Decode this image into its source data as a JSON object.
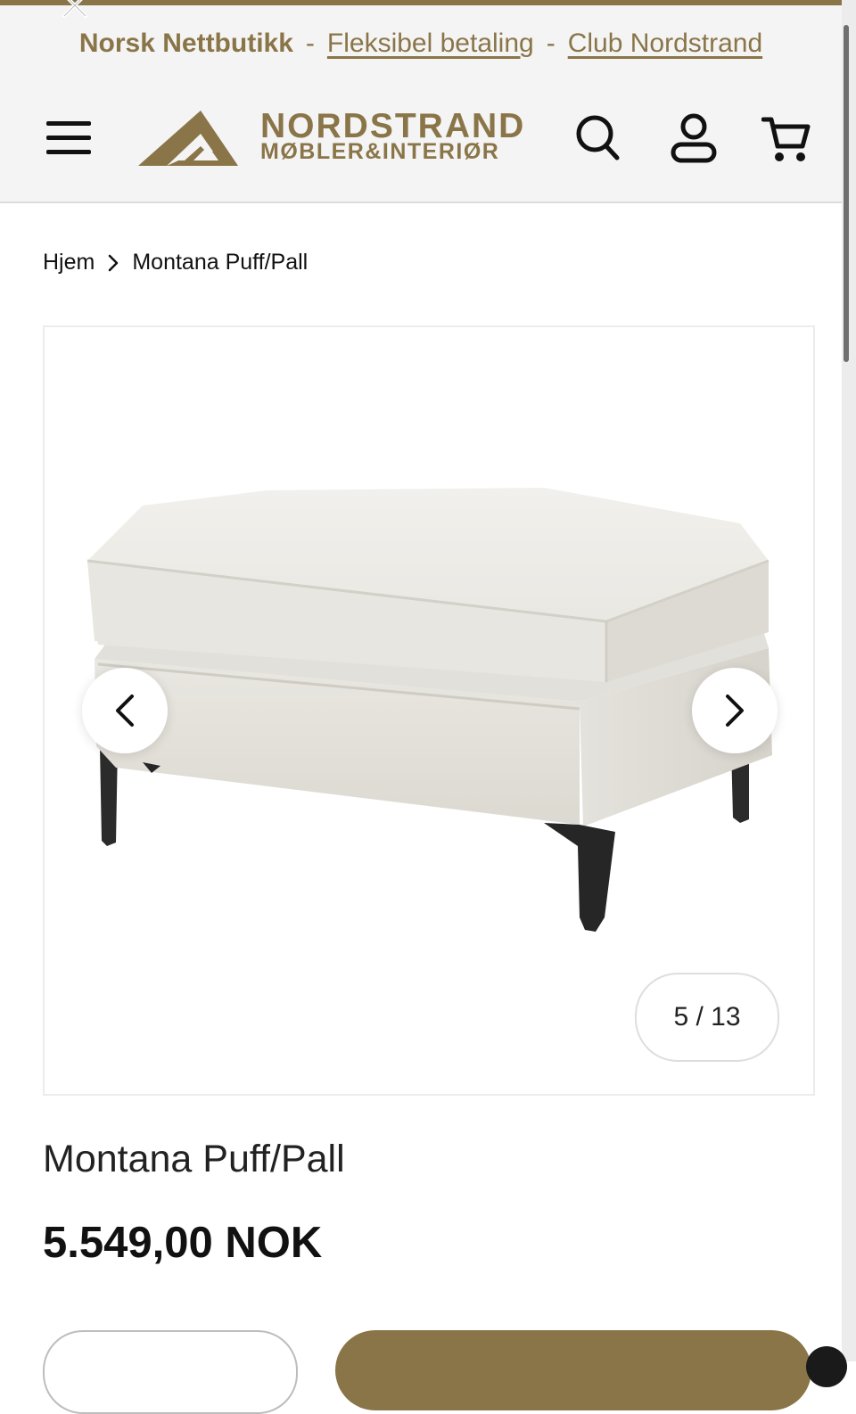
{
  "colors": {
    "accent": "#8a7548",
    "text": "#111111",
    "background": "#ffffff"
  },
  "promo": {
    "text1": "Norsk Nettbutikk",
    "sep1": "-",
    "link1": "Fleksibel betaling",
    "sep2": "-",
    "link2": "Club Nordstrand"
  },
  "header": {
    "logo_line1": "NORDSTRAND",
    "logo_line2": "MØBLER&INTERIØR",
    "icons": [
      "menu-icon",
      "search-icon",
      "user-icon",
      "cart-icon"
    ]
  },
  "breadcrumb": {
    "home": "Hjem",
    "separator_icon": "chevron-right-icon",
    "current": "Montana Puff/Pall"
  },
  "gallery": {
    "counter": "5 / 13",
    "current_index": 5,
    "total": 13
  },
  "product": {
    "title": "Montana Puff/Pall",
    "price": "5.549,00 NOK"
  }
}
